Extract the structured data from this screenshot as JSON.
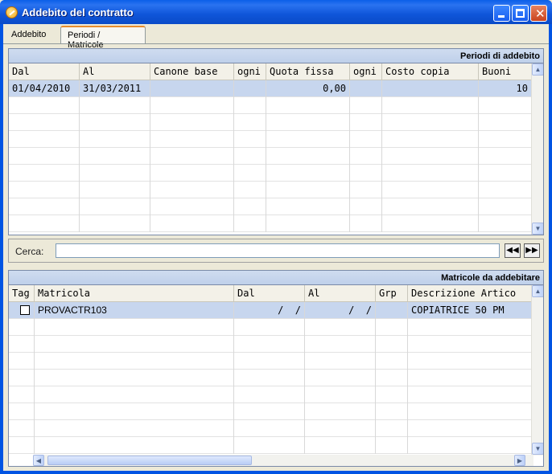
{
  "window": {
    "title": "Addebito del contratto"
  },
  "tabs": [
    {
      "label": "Addebito"
    },
    {
      "label": "Periodi / Matricole"
    }
  ],
  "periodi": {
    "header": "Periodi di addebito",
    "columns": [
      "Dal",
      "Al",
      "Canone base",
      "ogni",
      "Quota fissa",
      "ogni",
      "Costo copia",
      "Buoni"
    ],
    "rows": [
      {
        "dal": "01/04/2010",
        "al": "31/03/2011",
        "canone_base": "",
        "ogni1": "",
        "quota_fissa": "0,00",
        "ogni2": "",
        "costo_copia": "",
        "buoni": "10"
      }
    ]
  },
  "search": {
    "label": "Cerca:",
    "value": "",
    "prev_label": "◀◀",
    "next_label": "▶▶"
  },
  "matricole": {
    "header": "Matricole da addebitare",
    "columns": [
      "Tag",
      "Matricola",
      "Dal",
      "Al",
      "Grp",
      "Descrizione Artico"
    ],
    "rows": [
      {
        "tag": false,
        "matricola": "PROVACTR103",
        "dal": "  /  /",
        "al": "  /  /",
        "grp": "",
        "descrizione": "COPIATRICE 50 PM"
      }
    ]
  },
  "colors": {
    "title_bar": "#0a5fe8",
    "selected_row": "#c7d6ee",
    "section_header": "#c8d7ee"
  }
}
